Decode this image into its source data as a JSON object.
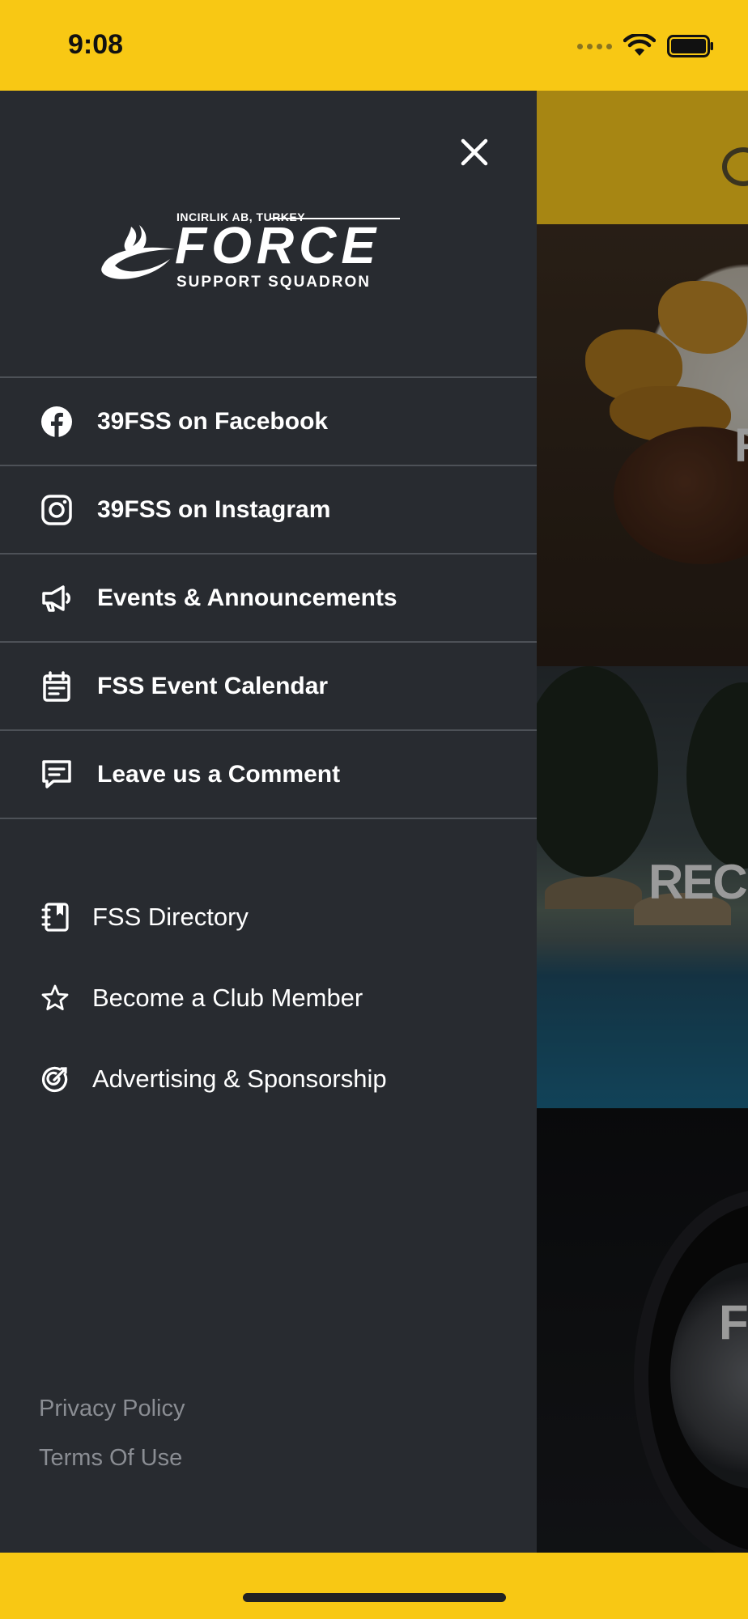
{
  "status_bar": {
    "time": "9:08"
  },
  "drawer": {
    "logo": {
      "top_text": "INCIRLIK AB, TURKEY",
      "word": "FORCE",
      "sub_text": "SUPPORT SQUADRON"
    },
    "primary_menu": [
      {
        "label": "39FSS on Facebook",
        "icon": "facebook-icon"
      },
      {
        "label": "39FSS on Instagram",
        "icon": "instagram-icon"
      },
      {
        "label": "Events & Announcements",
        "icon": "megaphone-icon"
      },
      {
        "label": "FSS Event Calendar",
        "icon": "calendar-icon"
      },
      {
        "label": "Leave us a Comment",
        "icon": "comment-icon"
      }
    ],
    "secondary_menu": [
      {
        "label": "FSS Directory",
        "icon": "notebook-icon"
      },
      {
        "label": "Become a Club Member",
        "icon": "star-icon"
      },
      {
        "label": "Advertising & Sponsorship",
        "icon": "target-icon"
      }
    ],
    "footer": {
      "privacy": "Privacy Policy",
      "terms": "Terms Of Use"
    }
  },
  "background_panels": [
    {
      "label": "F"
    },
    {
      "label": "RECI"
    },
    {
      "label": "F"
    }
  ],
  "colors": {
    "brand_yellow": "#F8C814",
    "drawer_bg": "#282B30",
    "divider": "#4d5157",
    "footer_text": "#8a8d93"
  }
}
